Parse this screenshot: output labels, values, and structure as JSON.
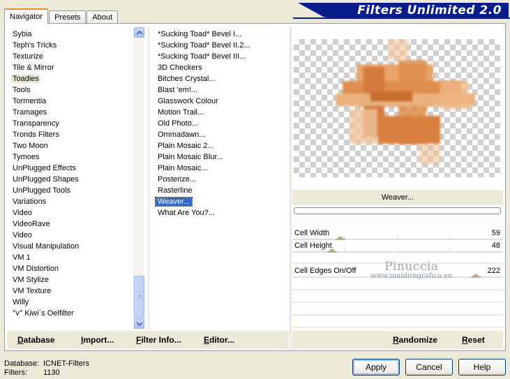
{
  "tabs": [
    "Navigator",
    "Presets",
    "About"
  ],
  "banner": "Filters Unlimited 2.0",
  "categories": [
    "Sybia",
    "Teph's Tricks",
    "Texturize",
    "Tile & Mirror",
    "Toadies",
    "Tools",
    "Tormentia",
    "Tramages",
    "Transparency",
    "Tronds Filters",
    "Two Moon",
    "Tymoes",
    "UnPlugged Effects",
    "UnPlugged Shapes",
    "UnPlugged Tools",
    "Variations",
    "Video",
    "VideoRave",
    "Video",
    "Visual Manipulation",
    "VM 1",
    "VM Distortion",
    "VM Stylize",
    "VM Texture",
    "Willy",
    "°v° Kiwi`s Oelfilter"
  ],
  "filters": [
    "*Sucking Toad*  Bevel I...",
    "*Sucking Toad*  Bevel II.2...",
    "*Sucking Toad*  Bevel III...",
    "3D Checkers",
    "Bitches Crystal...",
    "Blast 'em!...",
    "Glasswork Colour",
    "Motion Trail...",
    "Old Photo...",
    "Ommadawn...",
    "Plain Mosaic 2...",
    "Plain Mosaic Blur...",
    "Plain Mosaic...",
    "Posterize...",
    "Rasterline",
    "Weaver...",
    "What Are You?..."
  ],
  "selected_filter_name": "Weaver...",
  "params": [
    {
      "label": "Cell Width",
      "value": "59",
      "level": 0.23
    },
    {
      "label": "Cell Height",
      "value": "48",
      "level": 0.19
    },
    {
      "label": "Cell Edges On/Off",
      "value": "222",
      "level": 0.87
    }
  ],
  "watermark": {
    "name": "Pinuccia",
    "site": "www.maidiregrafica.eu"
  },
  "bottom_links": {
    "database": "Database",
    "import": "Import...",
    "filter_info": "Filter Info...",
    "editor": "Editor...",
    "randomize": "Randomize",
    "reset": "Reset"
  },
  "footer": {
    "database_label": "Database:",
    "database_value": "ICNET-Filters",
    "filters_label": "Filters:",
    "filters_value": "1130"
  },
  "buttons": {
    "apply": "Apply",
    "cancel": "Cancel",
    "help": "Help"
  },
  "colors": {
    "banner": "#0a1d8a",
    "selection": "#316ac5",
    "tab_accent": "#e68b2c"
  }
}
